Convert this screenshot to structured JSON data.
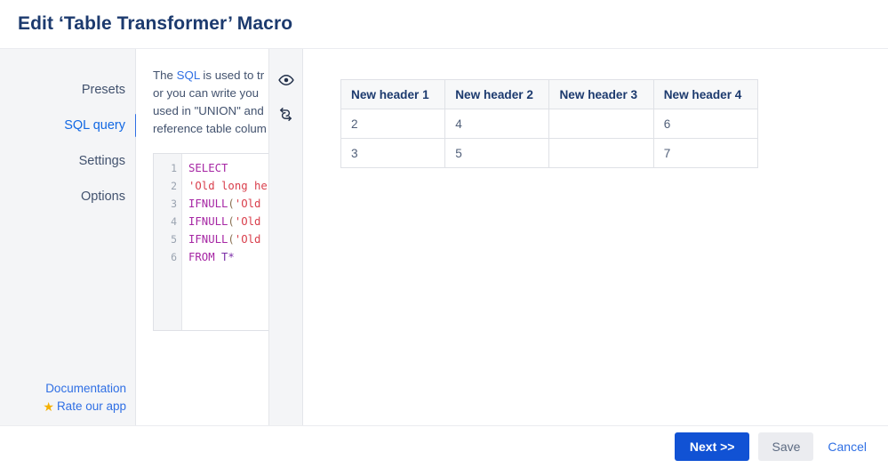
{
  "header": {
    "title": "Edit ‘Table Transformer’ Macro"
  },
  "sidebar": {
    "items": [
      {
        "label": "Presets",
        "active": false
      },
      {
        "label": "SQL query",
        "active": true
      },
      {
        "label": "Settings",
        "active": false
      },
      {
        "label": "Options",
        "active": false
      }
    ],
    "footer": {
      "documentation_label": "Documentation",
      "rate_label": "Rate our app",
      "star_icon": "★"
    }
  },
  "form_panel": {
    "description": {
      "line1_prefix": "The ",
      "line1_link": "SQL",
      "line1_suffix": " is used to tr",
      "line2": "or you can write you",
      "line3": "used in \"UNION\" and",
      "line4": "reference table colum"
    },
    "editor": {
      "line_numbers": [
        "1",
        "2",
        "3",
        "4",
        "5",
        "6"
      ],
      "lines": [
        {
          "kw": "SELECT",
          "rest": ""
        },
        {
          "kw": "",
          "str": "'Old long he"
        },
        {
          "kw": "IFNULL",
          "punct": "(",
          "str": "'Old"
        },
        {
          "kw": "IFNULL",
          "punct": "(",
          "str": "'Old"
        },
        {
          "kw": "IFNULL",
          "punct": "(",
          "str": "'Old"
        },
        {
          "kw": "FROM",
          "id": " T*"
        }
      ],
      "l1": "SELECT",
      "l2": "'Old long he",
      "l3_kw": "IFNULL",
      "l3_p": "(",
      "l3_s": "'Old",
      "l4_kw": "IFNULL",
      "l4_p": "(",
      "l4_s": "'Old",
      "l5_kw": "IFNULL",
      "l5_p": "(",
      "l5_s": "'Old",
      "l6_kw": "FROM",
      "l6_id": " T*"
    }
  },
  "icon_rail": {
    "preview_icon": "eye-icon",
    "refresh_icon": "refresh-icon"
  },
  "preview": {
    "table": {
      "headers": [
        "New header 1",
        "New header 2",
        "New header 3",
        "New header 4"
      ],
      "rows": [
        [
          "2",
          "4",
          "",
          "6"
        ],
        [
          "3",
          "5",
          "",
          "7"
        ]
      ]
    }
  },
  "footer": {
    "next_label": "Next >>",
    "save_label": "Save",
    "cancel_label": "Cancel"
  },
  "colors": {
    "accent_blue": "#1152d4",
    "link_blue": "#2f6fe4",
    "title_navy": "#1c3a6e",
    "sidebar_bg": "#f4f5f7",
    "star_gold": "#f5b000",
    "code_keyword": "#a626a4",
    "code_string": "#d93f4c"
  }
}
